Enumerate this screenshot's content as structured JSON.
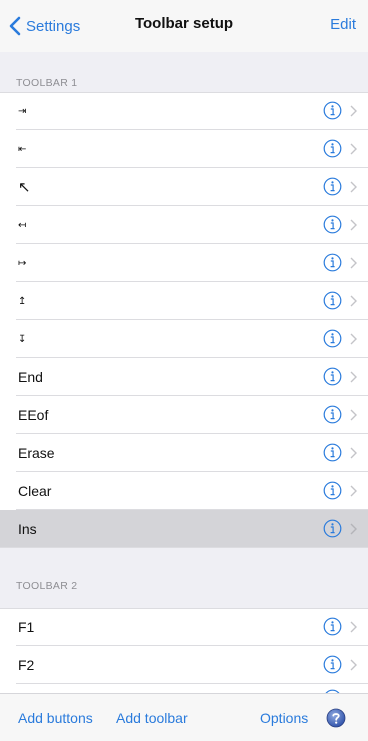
{
  "navbar": {
    "back_label": "Settings",
    "title": "Toolbar setup",
    "edit_label": "Edit"
  },
  "sections": [
    {
      "header": "TOOLBAR 1",
      "items": [
        {
          "label": "⇥",
          "kind": "glyph"
        },
        {
          "label": "⇤",
          "kind": "glyph"
        },
        {
          "label": "↖",
          "kind": "glyph-big"
        },
        {
          "label": "↤",
          "kind": "glyph"
        },
        {
          "label": "↦",
          "kind": "glyph"
        },
        {
          "label": "↥",
          "kind": "glyph"
        },
        {
          "label": "↧",
          "kind": "glyph"
        },
        {
          "label": "End",
          "kind": "text"
        },
        {
          "label": "EEof",
          "kind": "text"
        },
        {
          "label": "Erase",
          "kind": "text"
        },
        {
          "label": "Clear",
          "kind": "text"
        },
        {
          "label": "Ins",
          "kind": "text",
          "selected": true
        }
      ]
    },
    {
      "header": "TOOLBAR 2",
      "items": [
        {
          "label": "F1",
          "kind": "text"
        },
        {
          "label": "F2",
          "kind": "text"
        }
      ]
    }
  ],
  "toolbar": {
    "add_buttons_label": "Add buttons",
    "add_toolbar_label": "Add toolbar",
    "options_label": "Options"
  },
  "colors": {
    "accent": "#2a7bdc",
    "selected_row": "#d4d4d8",
    "group_background": "#efeff4"
  },
  "icons": {
    "back": "chevron-left-icon",
    "info": "info-circle-icon",
    "disclosure": "chevron-right-icon",
    "help": "question-mark-circle-icon"
  }
}
